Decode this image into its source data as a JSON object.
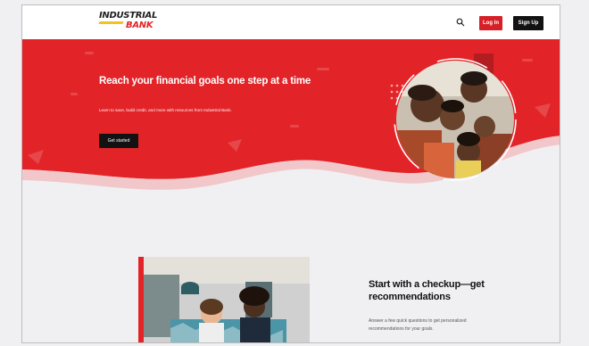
{
  "brand": {
    "line1": "INDUSTRIAL",
    "line2": "BANK",
    "red": "#e22428",
    "yellow": "#f3c21c"
  },
  "header": {
    "search_icon": "search-icon",
    "login_label": "Log In",
    "signup_label": "Sign Up"
  },
  "hero": {
    "title": "Reach your financial goals one step at a time",
    "subtitle": "Learn to save, build credit, and more with resources from Industrial Bank.",
    "cta_label": "Get started",
    "background": "#e22428"
  },
  "checkup": {
    "title": "Start with a checkup—get recommendations",
    "text": "Answer a few quick questions to get personalized recommendations for your goals."
  }
}
